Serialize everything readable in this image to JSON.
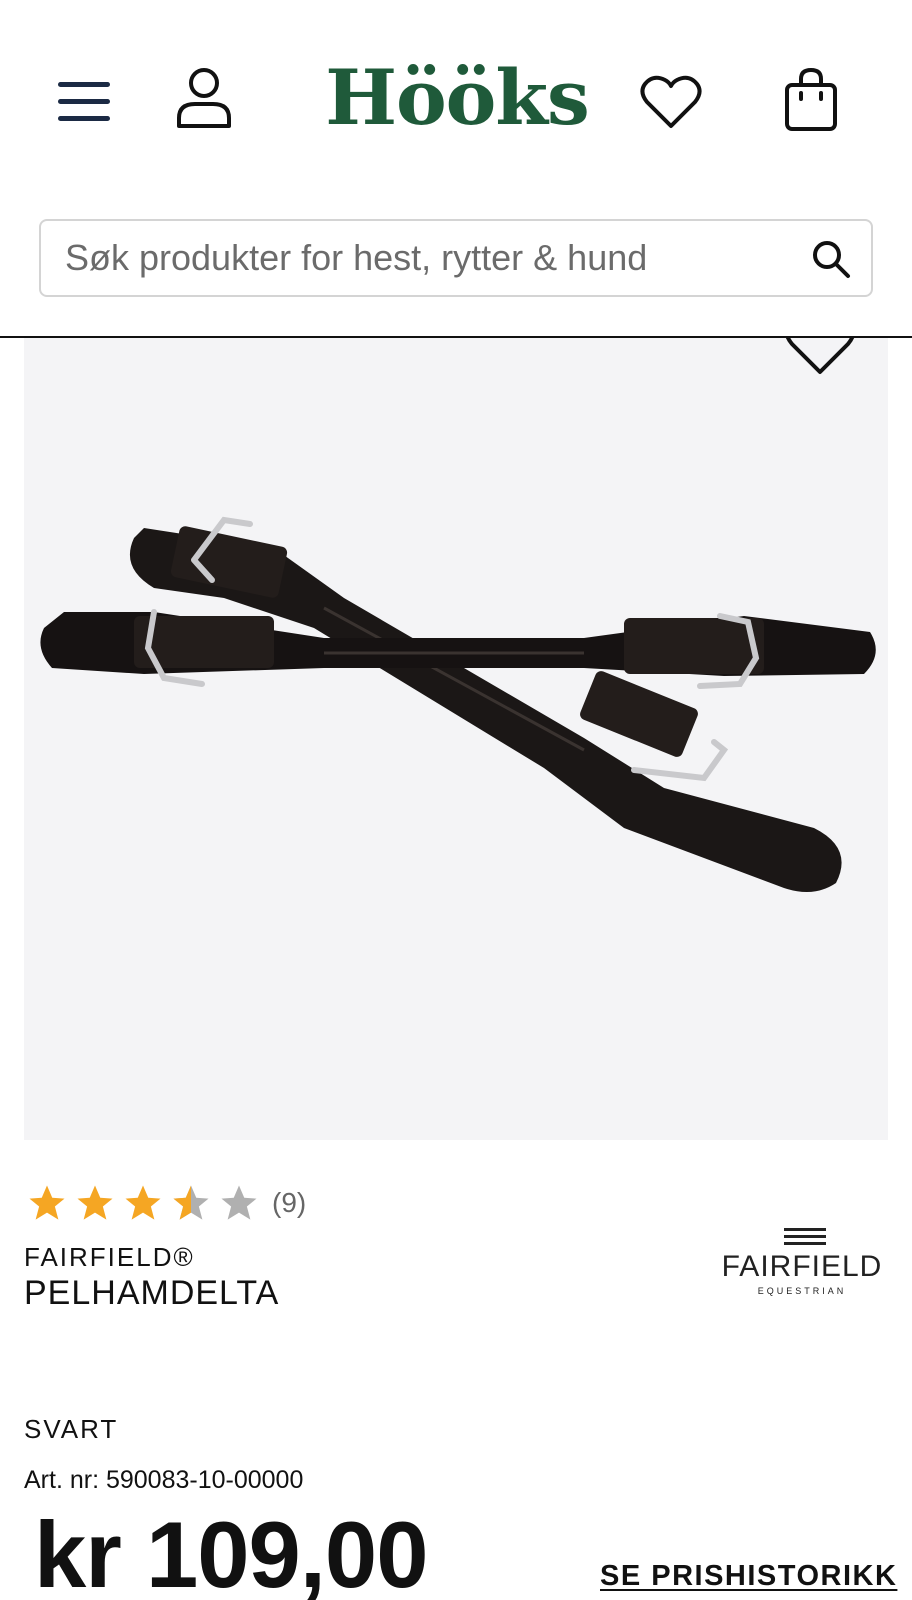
{
  "header": {
    "logo_text": "Hööks",
    "brand_color": "#1f5a3a",
    "icons": [
      "menu-icon",
      "account-icon",
      "heart-icon",
      "shopping-bag-icon"
    ]
  },
  "search": {
    "placeholder": "Søk produkter for hest, rytter & hund",
    "icon": "search-icon"
  },
  "product": {
    "image_alt": "Pelhamdelta",
    "rating_value": 3.5,
    "rating_max": 5,
    "rating_count": "(9)",
    "brand": "FAIRFIELD®",
    "title": "PELHAMDELTA",
    "brand_logo_text": "FAIRFIELD",
    "brand_logo_subtext": "EQUESTRIAN",
    "color": "SVART",
    "article_number": "Art. nr: 590083-10-00000",
    "price": "kr 109,00",
    "price_history_link": "SE PRISHISTORIKK",
    "star_color": "#f5a623",
    "star_empty_color": "#b0b0b0"
  }
}
